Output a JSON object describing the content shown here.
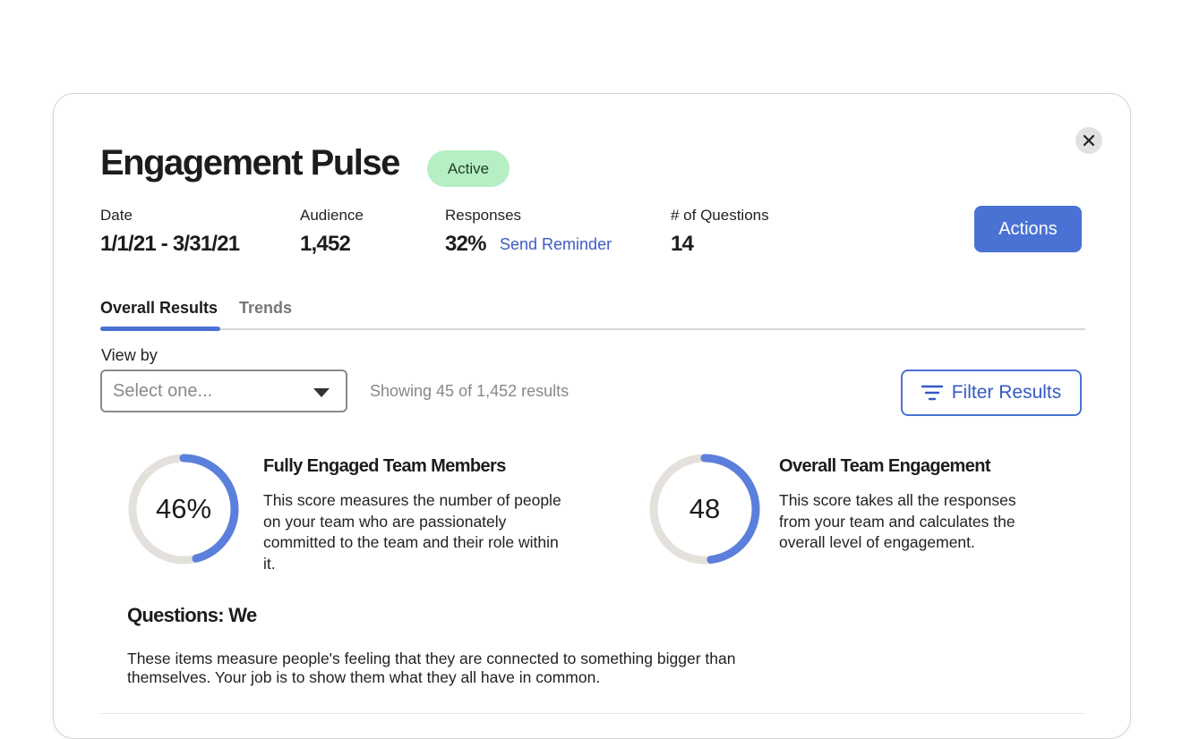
{
  "header": {
    "title": "Engagement Pulse",
    "status_badge": "Active",
    "close_icon": "close-icon"
  },
  "meta": {
    "date": {
      "label": "Date",
      "value": "1/1/21 - 3/31/21"
    },
    "audience": {
      "label": "Audience",
      "value": "1,452"
    },
    "responses": {
      "label": "Responses",
      "value": "32%",
      "action": "Send Reminder"
    },
    "questions": {
      "label": "# of Questions",
      "value": "14"
    }
  },
  "actions_button": "Actions",
  "tabs": [
    {
      "label": "Overall Results",
      "active": true
    },
    {
      "label": "Trends",
      "active": false
    }
  ],
  "view_by": {
    "label": "View by",
    "placeholder": "Select one...",
    "showing_text": "Showing 45 of 1,452 results"
  },
  "filter_button": {
    "label": "Filter Results",
    "icon": "filter-icon"
  },
  "metrics": [
    {
      "value_text": "46%",
      "fraction": 0.46,
      "title": "Fully Engaged Team Members",
      "description": "This score measures the number of people on your team who are passionately committed to the team and their role within it."
    },
    {
      "value_text": "48",
      "fraction": 0.48,
      "title": "Overall Team Engagement",
      "description": "This score takes all the responses from your team and calculates the overall level of engagement."
    }
  ],
  "questions_section": {
    "title": "Questions: We",
    "description": "These items measure people's feeling that they are connected to something bigger than themselves. Your job is to show them what they all have in common."
  },
  "colors": {
    "accent": "#4a72d4",
    "ring_track": "#e4e1dd",
    "ring_fill": "#5b7fdc",
    "badge_bg": "#b6efc4"
  }
}
